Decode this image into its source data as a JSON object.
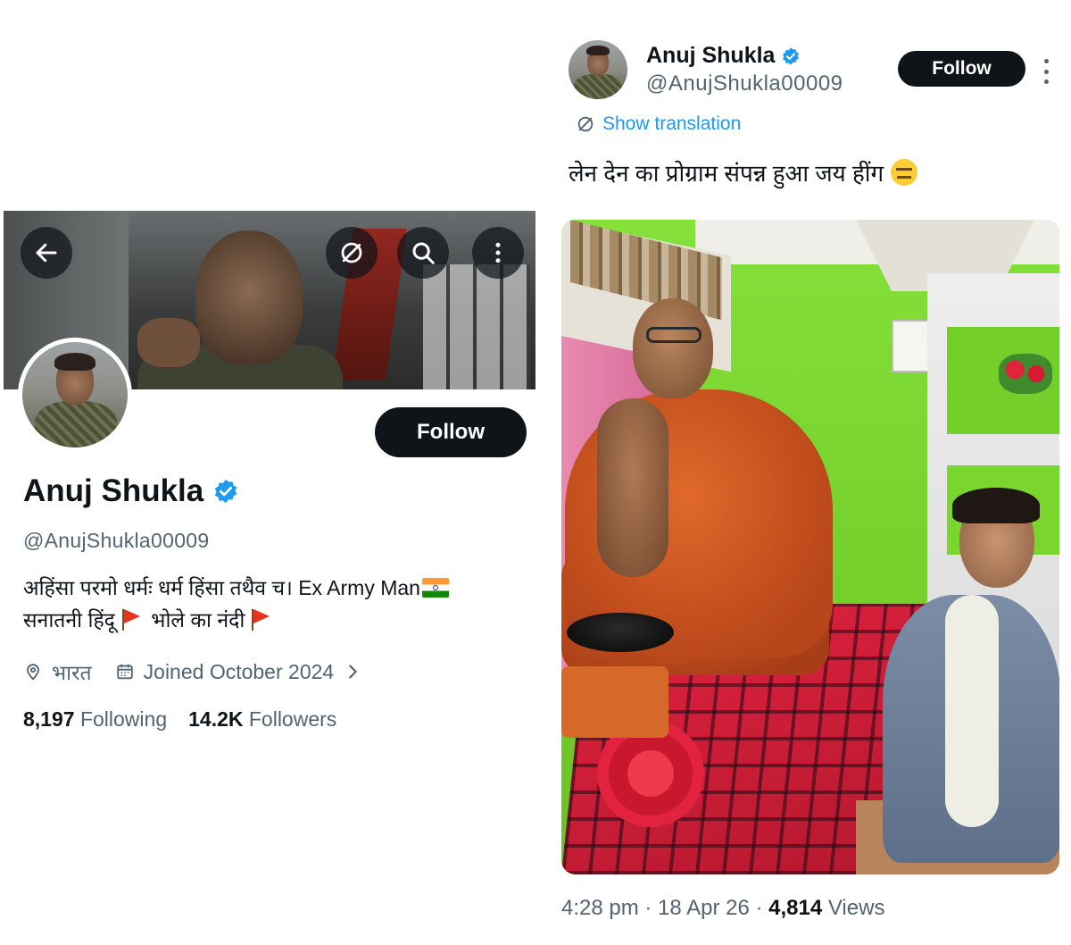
{
  "profile": {
    "name": "Anuj Shukla",
    "handle": "@AnujShukla00009",
    "bio_line1": "अहिंसा परमो धर्मः धर्म हिंसा तथैव च। Ex Army Man",
    "bio_line2_a": "सनातनी हिंदू",
    "bio_line2_b": "भोले का नंदी",
    "location": "भारत",
    "joined": "Joined October 2024",
    "following_count": "8,197",
    "following_label": "Following",
    "followers_count": "14.2K",
    "followers_label": "Followers",
    "follow_label": "Follow",
    "icons": [
      "back-arrow-icon",
      "no-translate-icon",
      "search-icon",
      "more-vertical-icon",
      "verified-badge-icon",
      "location-icon",
      "calendar-icon",
      "chevron-right-icon"
    ]
  },
  "tweet": {
    "name": "Anuj Shukla",
    "handle": "@AnujShukla00009",
    "follow_label": "Follow",
    "show_translation": "Show translation",
    "text": "लेन देन का प्रोग्राम संपन्न हुआ जय हींग",
    "time": "4:28 pm",
    "date": "18 Apr 26",
    "views_count": "4,814",
    "views_label": "Views"
  },
  "colors": {
    "text": "#0f1419",
    "secondary": "#536471",
    "link": "#1d9bf0",
    "verified": "#1d9bf0",
    "button_bg": "#0f1419"
  }
}
